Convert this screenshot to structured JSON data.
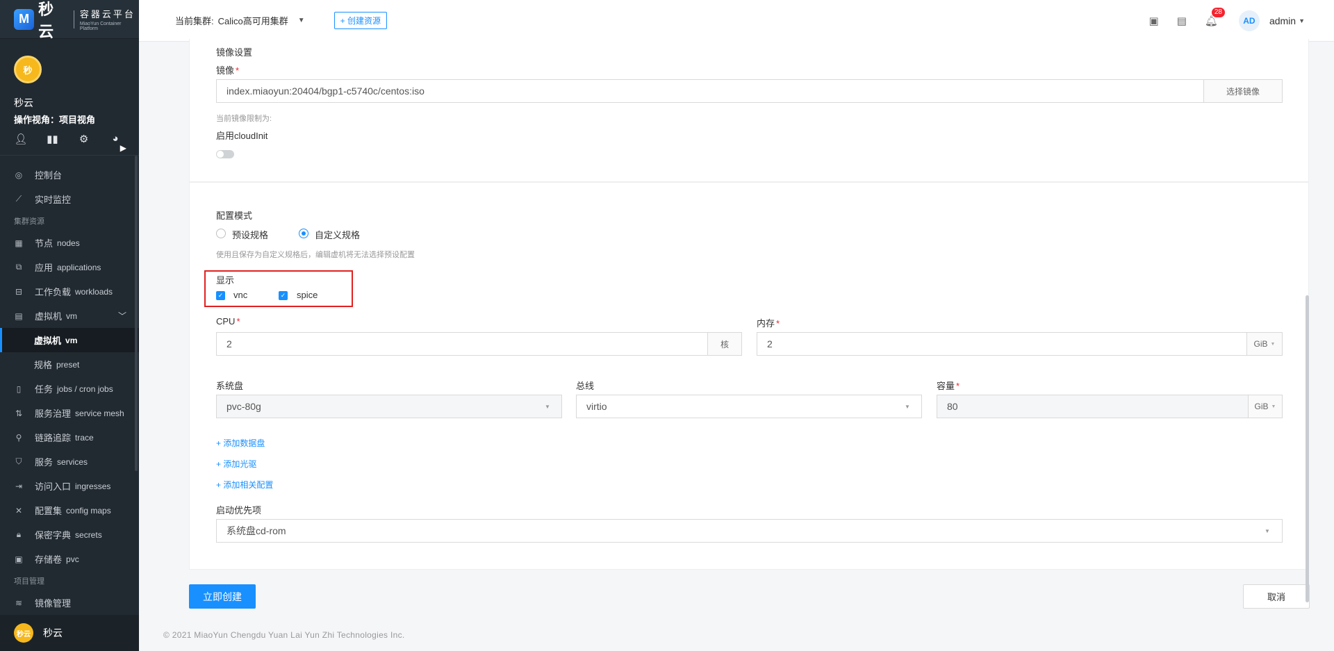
{
  "sidebar": {
    "logo_text": "秒云",
    "logo_mark": "M",
    "logo_sub_cn": "容器云平台",
    "logo_sub_en": "MiaoYun Container Platform",
    "avatar_text": "秒",
    "user_name": "秒云",
    "view_label": "操作视角：项目视角",
    "profile_icons": [
      "user-icon",
      "bar-chart-icon",
      "gear-icon",
      "pie-chart-icon"
    ],
    "menu": {
      "console": "控制台",
      "monitor": "实时监控",
      "group_cluster": "集群资源",
      "nodes": {
        "label": "节点",
        "en": "nodes"
      },
      "applications": {
        "label": "应用",
        "en": "applications"
      },
      "workloads": {
        "label": "工作负载",
        "en": "workloads"
      },
      "vm_parent": {
        "label": "虚拟机",
        "en": "vm"
      },
      "vm_child": {
        "label": "虚拟机",
        "en": "vm"
      },
      "preset": {
        "label": "规格",
        "en": "preset"
      },
      "jobs": {
        "label": "任务",
        "en": "jobs / cron jobs"
      },
      "service_mesh": {
        "label": "服务治理",
        "en": "service mesh"
      },
      "trace": {
        "label": "链路追踪",
        "en": "trace"
      },
      "services": {
        "label": "服务",
        "en": "services"
      },
      "ingresses": {
        "label": "访问入口",
        "en": "ingresses"
      },
      "config_maps": {
        "label": "配置集",
        "en": "config maps"
      },
      "secrets": {
        "label": "保密字典",
        "en": "secrets"
      },
      "pvc": {
        "label": "存储卷",
        "en": "pvc"
      },
      "group_project": "项目管理",
      "image_mgmt": "镜像管理"
    },
    "footer_avatar": "秒云",
    "footer_name": "秒云"
  },
  "header": {
    "cluster_label": "当前集群:",
    "cluster_value": "Calico高可用集群",
    "create_button": "+ 创建资源",
    "notification_count": "28",
    "avatar_initials": "AD",
    "user": "admin"
  },
  "form": {
    "image_section_title": "镜像设置",
    "image_label": "镜像",
    "image_value": "index.miaoyun:20404/bgp1-c5740c/centos:iso",
    "select_image_button": "选择镜像",
    "image_limit_hint": "当前镜像限制为:",
    "cloudinit_label": "启用cloudInit",
    "cloudinit_enabled": false,
    "config_mode_label": "配置模式",
    "mode_preset": "预设规格",
    "mode_custom": "自定义规格",
    "selected_mode": "自定义规格",
    "mode_hint": "使用且保存为自定义规格后，编辑虚机将无法选择预设配置",
    "display_label": "显示",
    "display_vnc": "vnc",
    "display_spice": "spice",
    "cpu_label": "CPU",
    "cpu_value": "2",
    "cpu_unit": "核",
    "memory_label": "内存",
    "memory_value": "2",
    "memory_unit": "GiB",
    "system_disk_label": "系统盘",
    "system_disk_value": "pvc-80g",
    "bus_label": "总线",
    "bus_value": "virtio",
    "capacity_label": "容量",
    "capacity_value": "80",
    "capacity_unit": "GiB",
    "add_data_disk": "+ 添加数据盘",
    "add_cdrom": "+ 添加光驱",
    "add_related_config": "+ 添加相关配置",
    "boot_priority_label": "启动优先项",
    "boot_priority_value": "系统盘cd-rom",
    "submit_button": "立即创建",
    "cancel_button": "取消"
  },
  "footer": {
    "copyright": "© 2021 MiaoYun Chengdu Yuan Lai Yun Zhi Technologies Inc."
  },
  "colors": {
    "primary": "#1890ff",
    "sidebar_bg": "#222a31",
    "required": "#f5222d",
    "highlight_box": "#e02020"
  }
}
